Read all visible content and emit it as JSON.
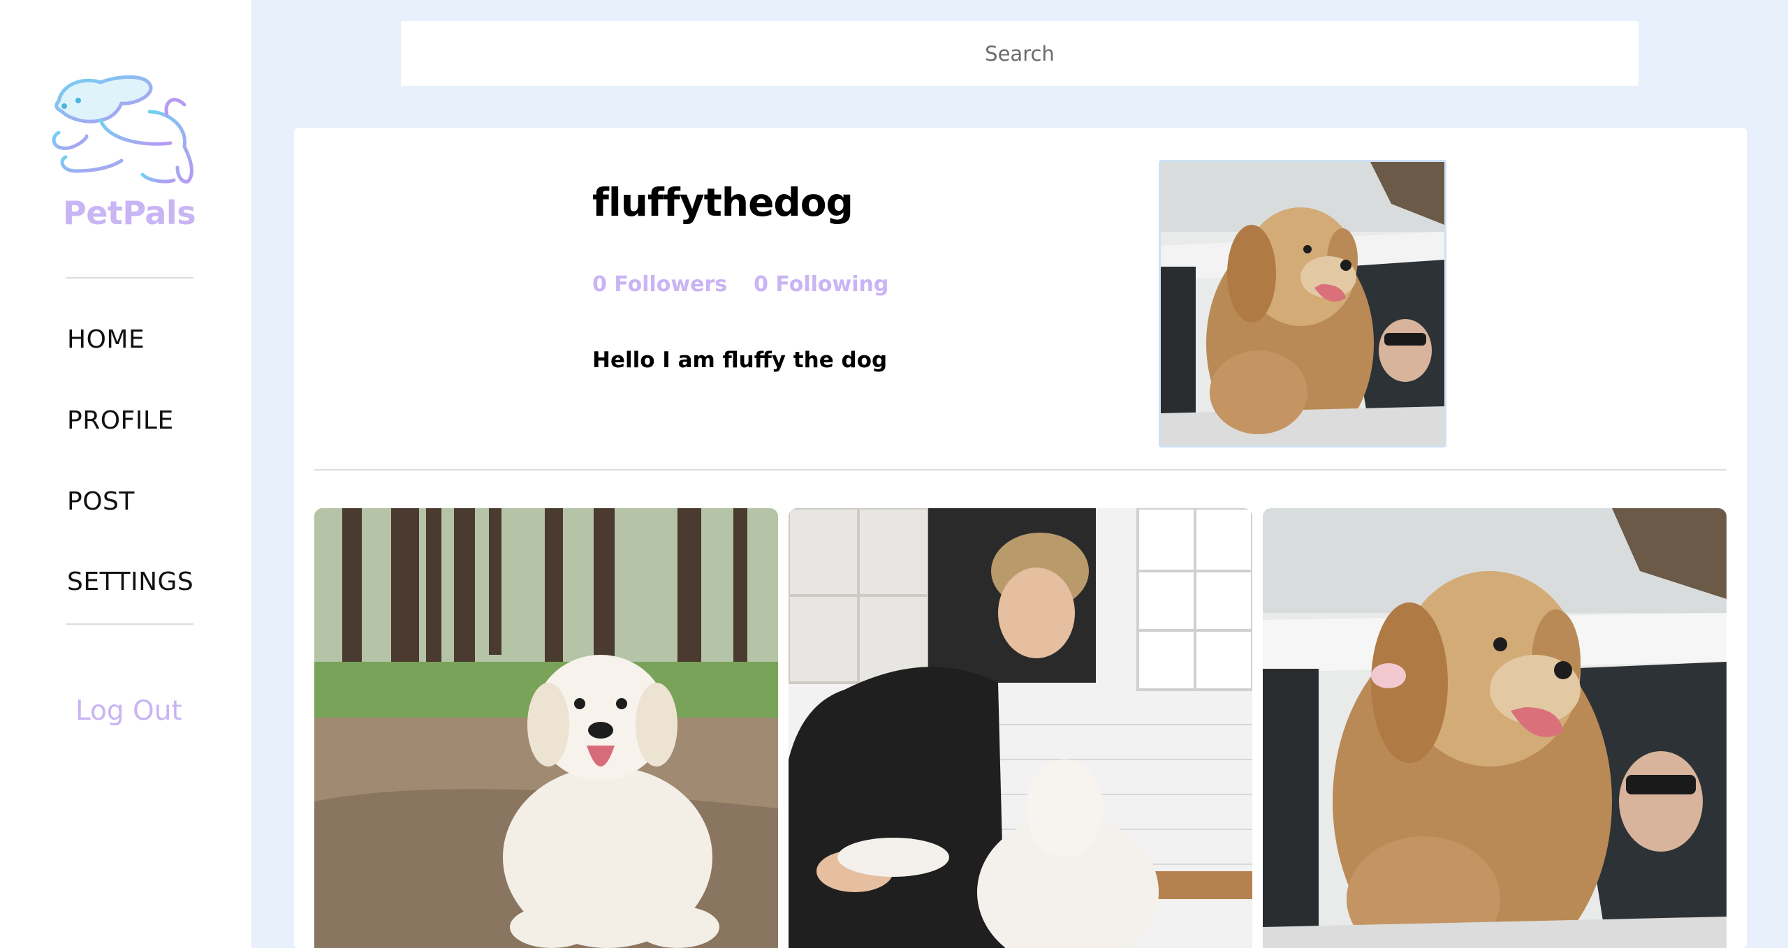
{
  "app": {
    "brand": "PetPals",
    "accent_color": "#c9b4f4",
    "background_color": "#e8f1fb"
  },
  "search": {
    "placeholder": "Search",
    "value": ""
  },
  "sidebar": {
    "items": [
      {
        "label": "HOME",
        "icon": "none"
      },
      {
        "label": "PROFILE",
        "icon": "none"
      },
      {
        "label": "POST",
        "icon": "none"
      },
      {
        "label": "SETTINGS",
        "icon": "none"
      }
    ],
    "logout_label": "Log Out"
  },
  "profile": {
    "username": "fluffythedog",
    "followers": "0 Followers",
    "following": "0 Following",
    "bio": "Hello I am fluffy the dog"
  },
  "posts": [
    {
      "description": "white-dog-in-forest-photo"
    },
    {
      "description": "man-with-white-dog-in-kitchen-photo"
    },
    {
      "description": "golden-dog-in-car-window-photo"
    }
  ]
}
